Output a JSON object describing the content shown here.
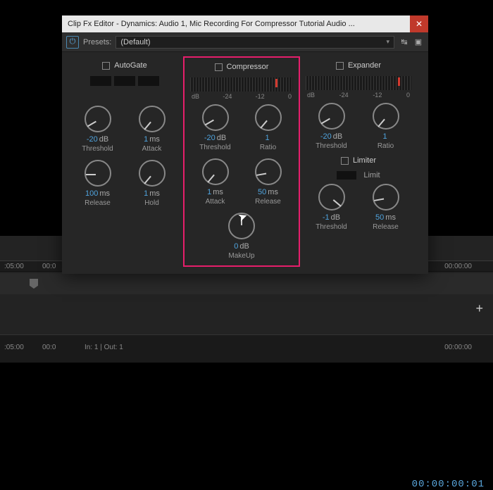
{
  "window": {
    "title": "Clip Fx Editor - Dynamics: Audio 1, Mic Recording For Compressor Tutorial Audio ..."
  },
  "presetbar": {
    "presets_label": "Presets:",
    "selected": "(Default)"
  },
  "bg": {
    "timecode": "00:00:00:01",
    "ruler_left": ":05:00",
    "ruler_mid": "00:0",
    "in_out": "In: 1 | Out: 1",
    "ruler_right": "00:00:00"
  },
  "modules": {
    "autogate": {
      "title": "AutoGate",
      "knobs": {
        "threshold": {
          "val": "-20",
          "unit": "dB",
          "label": "Threshold"
        },
        "attack": {
          "val": "1",
          "unit": "ms",
          "label": "Attack"
        },
        "release": {
          "val": "100",
          "unit": "ms",
          "label": "Release"
        },
        "hold": {
          "val": "1",
          "unit": "ms",
          "label": "Hold"
        }
      }
    },
    "compressor": {
      "title": "Compressor",
      "scale": {
        "a": "dB",
        "b": "-24",
        "c": "-12",
        "d": "0"
      },
      "knobs": {
        "threshold": {
          "val": "-20",
          "unit": "dB",
          "label": "Threshold"
        },
        "ratio": {
          "val": "1",
          "unit": "",
          "label": "Ratio"
        },
        "attack": {
          "val": "1",
          "unit": "ms",
          "label": "Attack"
        },
        "release": {
          "val": "50",
          "unit": "ms",
          "label": "Release"
        },
        "makeup": {
          "val": "0",
          "unit": "dB",
          "label": "MakeUp"
        }
      }
    },
    "expander": {
      "title": "Expander",
      "scale": {
        "a": "dB",
        "b": "-24",
        "c": "-12",
        "d": "0"
      },
      "knobs": {
        "threshold": {
          "val": "-20",
          "unit": "dB",
          "label": "Threshold"
        },
        "ratio": {
          "val": "1",
          "unit": "",
          "label": "Ratio"
        }
      }
    },
    "limiter": {
      "title": "Limiter",
      "limit_label": "Limit",
      "knobs": {
        "threshold": {
          "val": "-1",
          "unit": "dB",
          "label": "Threshold"
        },
        "release": {
          "val": "50",
          "unit": "ms",
          "label": "Release"
        }
      }
    }
  }
}
